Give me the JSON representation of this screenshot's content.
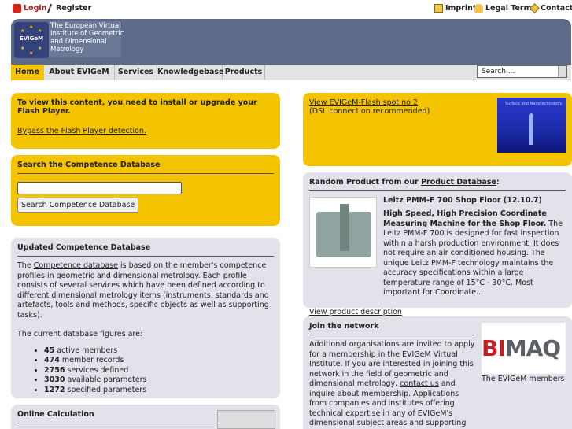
{
  "topbar": {
    "login": "Login",
    "register": "Register",
    "imprint": "Imprint",
    "legal": "Legal Terms",
    "contact": "Contact"
  },
  "header": {
    "logo_text": "EVIGeM",
    "brand_lines": [
      "The European Virtual",
      "Institute of Geometric",
      "and Dimensional",
      "Metrology"
    ]
  },
  "nav": {
    "tabs": [
      "Home",
      "About EVIGeM",
      "Services",
      "Knowledgebase",
      "Products"
    ],
    "search_placeholder": "Search ..."
  },
  "flash_panel": {
    "message": "To view this content, you need to install or upgrade your Flash Player.",
    "bypass_link": "Bypass the Flash Player detection."
  },
  "competence_search": {
    "title": "Search the Competence Database",
    "button": "Search Competence Database"
  },
  "updated": {
    "title": "Updated Competence Database",
    "p1_pre": "The ",
    "p1_link": "Competence database",
    "p1_post": " is based on the member's competence profiles in geometric and dimensional metrology. Each profile consists of several services which have been defined according to different dimensional metrology items (instruments, standards and artefacts, tools and methods, specific objects as well as supporting tasks).",
    "p2": "The current database figures are:",
    "stats": [
      {
        "num": "45",
        "label": " active members"
      },
      {
        "num": "474",
        "label": " member records"
      },
      {
        "num": "2756",
        "label": " services defined"
      },
      {
        "num": "3030",
        "label": " available parameters"
      },
      {
        "num": "1272",
        "label": " specified parameters"
      }
    ]
  },
  "online_calc": {
    "title": "Online Calculation"
  },
  "flash_spot": {
    "link": "View EVIGeM-Flash spot no 2",
    "note": "(DSL connection recommended)",
    "thumb_text": "Surface and Nanotechnology"
  },
  "random_product": {
    "title_pre": "Random Product from our ",
    "title_link": "Product Database",
    "title_post": ":",
    "product_name": "Leitz PMM-F 700 Shop Floor (12.10.7)",
    "desc_bold": "High Speed, High Precision Coordinate Measuring Machine for the Shop Floor.",
    "desc": " The Leitz PMM-F 700 is designed for fast inspection within a harsh production environment. It does not require an air conditioned housing. The unique Leitz PMM-F technology maintains the accuracy specifications within a large temperature range of 15°C - 30°C. Most important for Coordinate...",
    "view_link": "View product description"
  },
  "join": {
    "title": "Join the network",
    "text_pre": "Additional organisations are invited to apply for a membership in the EVIGeM Virtual Institute. If you are interested in joining this network in the field of geometric and dimensional metrology, ",
    "contact_link": "contact us",
    "text_post": " and inquire about membership. Applications from companies and institutes offering technical expertise in any of EVIGeM's dimensional subject areas and supporting tasks are always welcome.",
    "logo_bi": "BI",
    "logo_maq": "MAQ",
    "caption": "The EVIGeM members"
  }
}
